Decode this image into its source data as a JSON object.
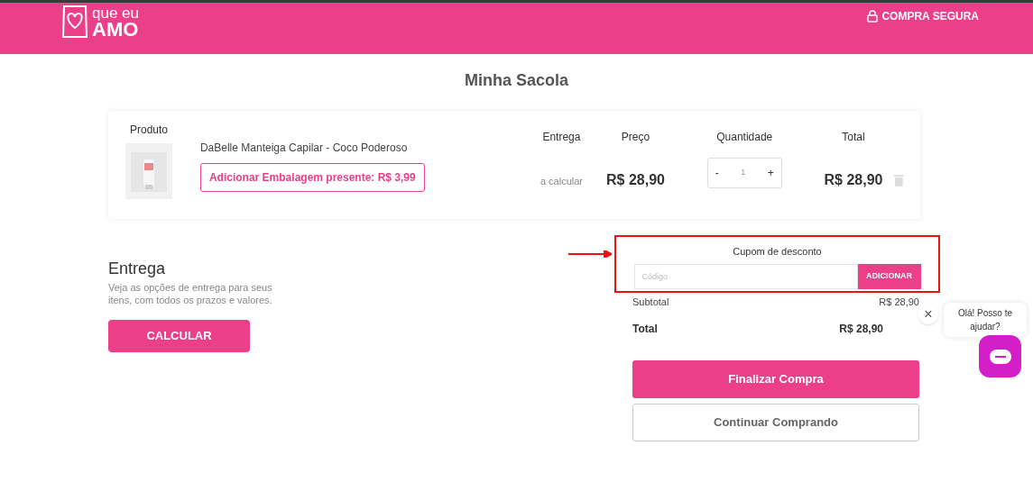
{
  "header": {
    "logo": [
      "que eu",
      "AMO"
    ],
    "secure_label": "COMPRA SEGURA"
  },
  "title": "Minha Sacola",
  "cart": {
    "columns": [
      "Produto",
      "Entrega",
      "Preço",
      "Quantidade",
      "Total"
    ],
    "items": [
      {
        "kind": "picture",
        "name": "DaBelle Manteiga Capilar - Coco Poderoso",
        "gift_button": "Adicionar Embalagem presente: R$ 3,99",
        "delivery": "a calcular",
        "price": "R$ 28,90",
        "minus": "-",
        "quantity": "1",
        "plus": "+",
        "total": "R$ 28,90"
      }
    ]
  },
  "delivery": {
    "title": "Entrega",
    "text": "Veja as opções de entrega para seus itens, com todos os prazos e valores.",
    "button": "CALCULAR"
  },
  "coupon": {
    "title": "Cupom de desconto",
    "placeholder": "Código",
    "button": "ADICIONAR"
  },
  "summary": [
    {
      "kind": "subtotal",
      "label": "Subtotal",
      "value": "R$ 28,90"
    },
    {
      "kind": "total",
      "label": "Total",
      "value": "R$ 28,90"
    }
  ],
  "actions": [
    {
      "kind": "primary",
      "label": "Finalizar Compra"
    },
    {
      "kind": "secondary",
      "label": "Continuar Comprando"
    }
  ],
  "chat": {
    "close": "×",
    "message": "Olá! Posso te ajudar?"
  }
}
